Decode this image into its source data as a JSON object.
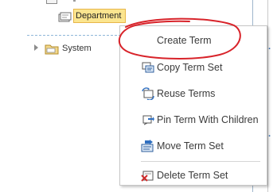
{
  "tree": {
    "selected_term": "Department",
    "system_label": "System"
  },
  "context_menu": {
    "items": [
      {
        "label": "Create Term",
        "icon": "create-term-icon"
      },
      {
        "label": "Copy Term Set",
        "icon": "copy-term-set-icon"
      },
      {
        "label": "Reuse Terms",
        "icon": "reuse-terms-icon"
      },
      {
        "label": "Pin Term With Children",
        "icon": "pin-term-icon"
      },
      {
        "label": "Move Term Set",
        "icon": "move-term-set-icon"
      },
      {
        "label": "Delete Term Set",
        "icon": "delete-term-set-icon"
      }
    ]
  },
  "colors": {
    "selection_fill": "#fbe58f",
    "selection_border": "#e8b64a",
    "annotation_red": "#d8232a",
    "tree_line": "#8fb6d9"
  }
}
